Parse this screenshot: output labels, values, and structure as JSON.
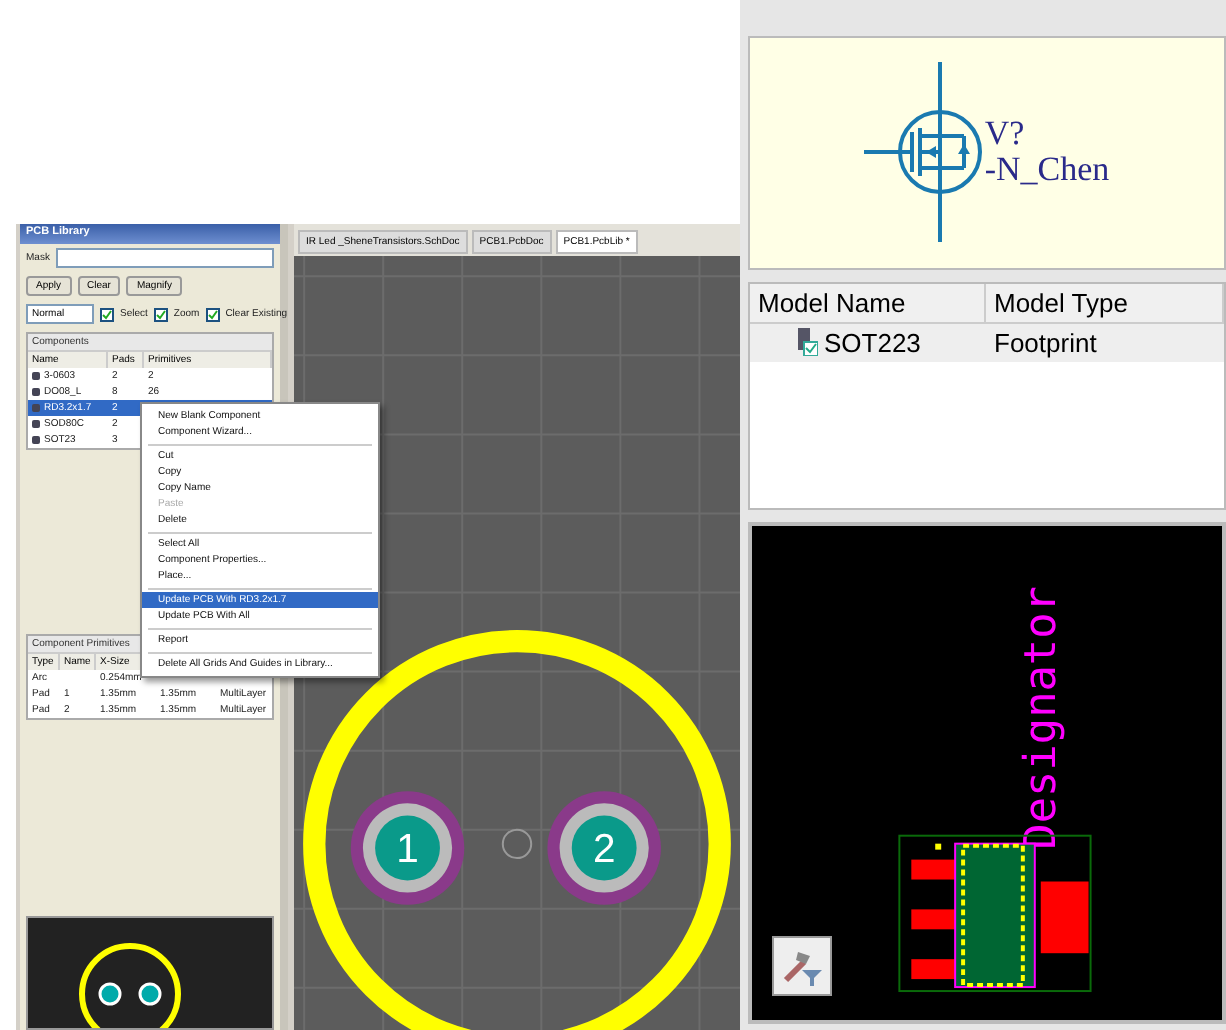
{
  "library_panel": {
    "title": "PCB Library",
    "mask_label": "Mask",
    "buttons": [
      {
        "label": "Apply"
      },
      {
        "label": "Clear"
      },
      {
        "label": "Magnify"
      }
    ],
    "mode": {
      "value": "Normal"
    },
    "options": [
      {
        "label": "Select",
        "checked": true
      },
      {
        "label": "Zoom",
        "checked": true
      },
      {
        "label": "Clear Existing",
        "checked": true
      }
    ],
    "components": {
      "title": "Components",
      "columns": [
        "Name",
        "Pads",
        "Primitives"
      ],
      "rows": [
        {
          "name": "3-0603",
          "pads": "2",
          "primitives": "2",
          "selected": false
        },
        {
          "name": "DO08_L",
          "pads": "8",
          "primitives": "26",
          "selected": false
        },
        {
          "name": "RD3.2x1.7",
          "pads": "2",
          "selected": true
        },
        {
          "name": "SOD80C",
          "pads": "2",
          "selected": false
        },
        {
          "name": "SOT23",
          "pads": "3",
          "selected": false
        }
      ]
    },
    "primitives": {
      "title": "Component Primitives",
      "columns": [
        "Type",
        "Name",
        "X-Size"
      ],
      "rows": [
        [
          "Arc",
          "",
          "0.254mm"
        ],
        [
          "Pad",
          "1",
          "1.35mm",
          "1.35mm",
          "MultiLayer"
        ],
        [
          "Pad",
          "2",
          "1.35mm",
          "1.35mm",
          "MultiLayer"
        ]
      ]
    }
  },
  "tabs": [
    {
      "label": "IR Led _SheneTransistors.SchDoc",
      "selected": false
    },
    {
      "label": "PCB1.PcbDoc",
      "selected": false
    },
    {
      "label": "PCB1.PcbLib *",
      "selected": true
    }
  ],
  "pads": [
    {
      "label": "1"
    },
    {
      "label": "2"
    }
  ],
  "context_menu": [
    {
      "kind": "item",
      "label": "New Blank Component",
      "disabled": false,
      "selected": false
    },
    {
      "kind": "item",
      "label": "Component Wizard...",
      "disabled": false,
      "selected": false
    },
    {
      "kind": "separator"
    },
    {
      "kind": "item",
      "label": "Cut",
      "disabled": false,
      "selected": false
    },
    {
      "kind": "item",
      "label": "Copy",
      "disabled": false,
      "selected": false
    },
    {
      "kind": "item",
      "label": "Copy Name",
      "disabled": false,
      "selected": false
    },
    {
      "kind": "item",
      "label": "Paste",
      "disabled": true,
      "selected": false
    },
    {
      "kind": "item",
      "label": "Delete",
      "disabled": false,
      "selected": false
    },
    {
      "kind": "separator"
    },
    {
      "kind": "item",
      "label": "Select All",
      "disabled": false,
      "selected": false
    },
    {
      "kind": "item",
      "label": "Component Properties...",
      "disabled": false,
      "selected": false
    },
    {
      "kind": "item",
      "label": "Place...",
      "disabled": false,
      "selected": false
    },
    {
      "kind": "separator"
    },
    {
      "kind": "item",
      "label": "Update PCB With RD3.2x1.7",
      "disabled": false,
      "selected": true
    },
    {
      "kind": "item",
      "label": "Update PCB With All",
      "disabled": false,
      "selected": false
    },
    {
      "kind": "separator"
    },
    {
      "kind": "item",
      "label": "Report",
      "disabled": false,
      "selected": false
    },
    {
      "kind": "separator"
    },
    {
      "kind": "item",
      "label": "Delete All Grids And Guides in Library...",
      "disabled": false,
      "selected": false
    }
  ],
  "symbol": {
    "designator": "V?",
    "name": "-N_Chen"
  },
  "models": {
    "columns": [
      "Model Name",
      "Model Type"
    ],
    "rows": [
      {
        "name": "SOT223",
        "type": "Footprint"
      }
    ]
  },
  "footprint": {
    "designator": "Designator"
  }
}
